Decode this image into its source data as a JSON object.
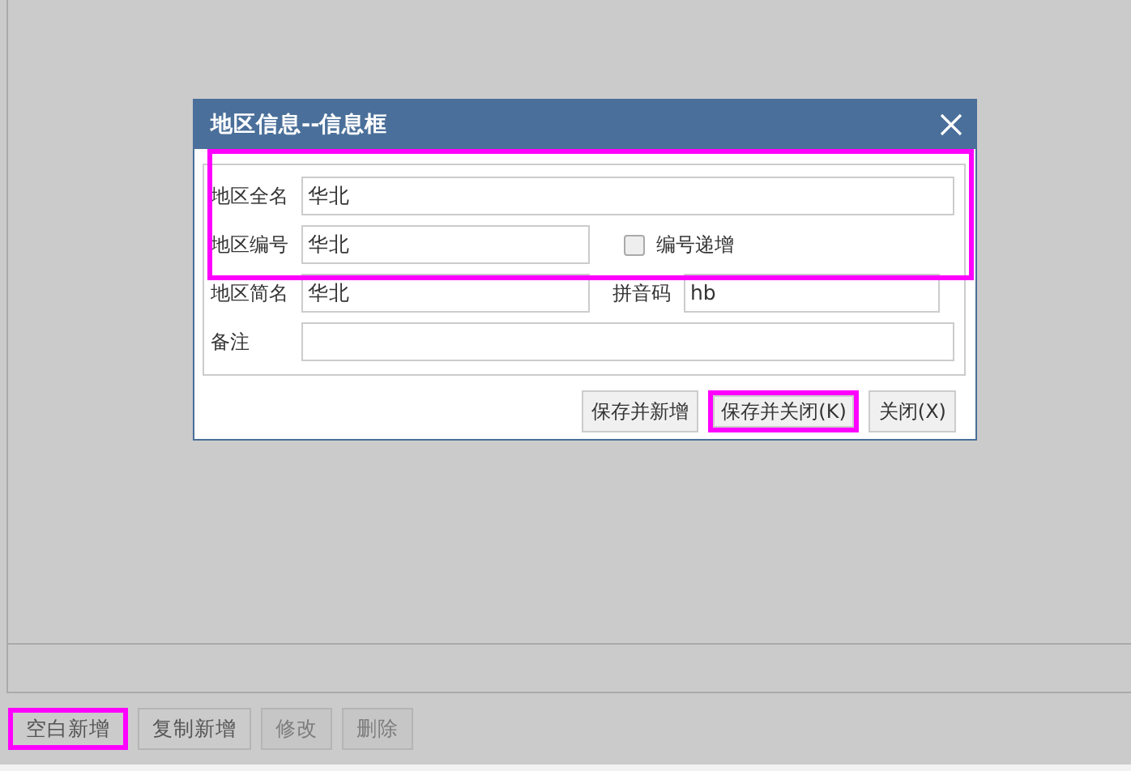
{
  "dialog": {
    "title": "地区信息--信息框",
    "form": {
      "highlighted": true,
      "full_name": {
        "label": "地区全名",
        "value": "华北"
      },
      "code": {
        "label": "地区编号",
        "value": "华北"
      },
      "auto_increment": {
        "label": "编号递增",
        "checked": false
      },
      "short_name": {
        "label": "地区简名",
        "value": "华北"
      },
      "pinyin": {
        "label": "拼音码",
        "value": "hb"
      },
      "remark": {
        "label": "备注"
      }
    },
    "buttons": [
      {
        "label": "保存并新增",
        "highlighted": false
      },
      {
        "label": "保存并关闭(K)",
        "highlighted": true
      },
      {
        "label": "关闭(X)",
        "highlighted": false
      }
    ]
  },
  "toolbar": [
    {
      "label": "空白新增",
      "disabled": false,
      "highlighted": true
    },
    {
      "label": "复制新增",
      "disabled": false,
      "highlighted": false
    },
    {
      "label": "修改",
      "disabled": true,
      "highlighted": false
    },
    {
      "label": "删除",
      "disabled": true,
      "highlighted": false
    }
  ]
}
